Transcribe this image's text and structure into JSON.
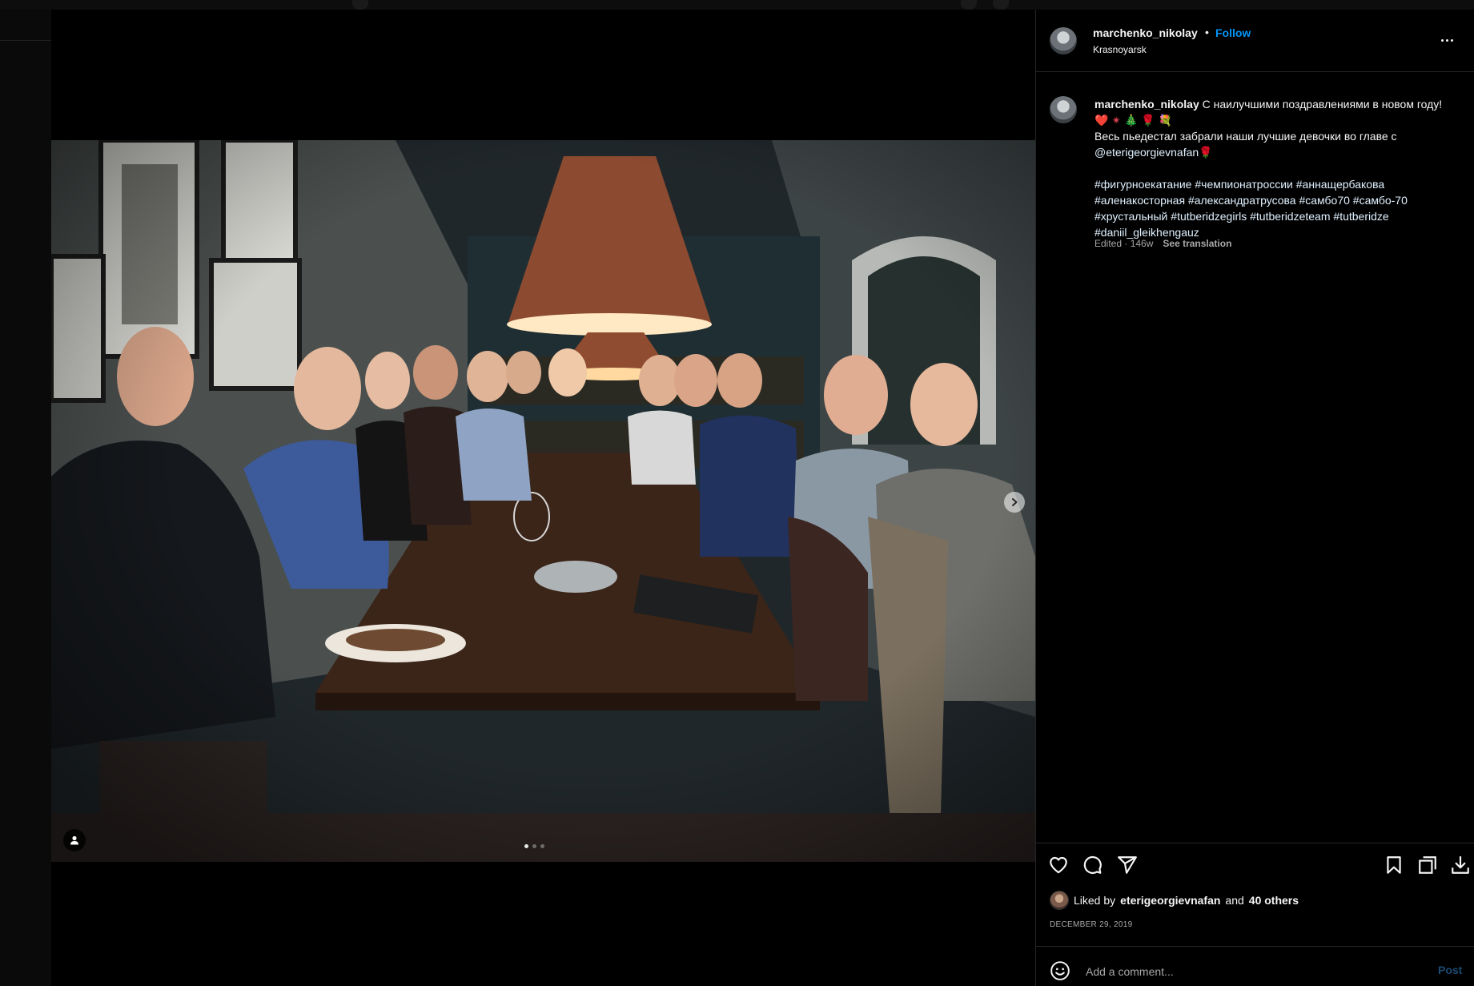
{
  "post": {
    "username": "marchenko_nikolay",
    "follow_label": "Follow",
    "header_separator": "•",
    "location": "Krasnoyarsk"
  },
  "caption": {
    "username": "marchenko_nikolay",
    "line1": " С наилучшими поздравлениями в новом году! ",
    "emoji_heart": "❤️",
    "emoji_sparkle": "✴",
    "emoji_tree": "🎄",
    "emoji_rose": "🌹",
    "emoji_bouquet": "💐",
    "line2": "\nВесь пьедестал забрали наши лучшие девочки во главе с\n",
    "mention": "@eterigeorgievnafan",
    "emoji_rose2": "🌹",
    "hashtags": [
      "#фигурноекатание",
      "#чемпионатроссии",
      "#аннащербакова",
      "#аленакосторная",
      "#александратрусова",
      "#самбо70",
      "#самбо-70",
      "#хрустальный",
      "#tutberidzegirls",
      "#tutberidzeteam",
      "#tutberidze",
      "#daniil_gleikhengauz"
    ],
    "meta_edited": "Edited · 146w",
    "see_translation": "See translation"
  },
  "actions": {
    "icons": [
      "heart-icon",
      "comment-icon",
      "share-icon",
      "bookmark-icon",
      "collection-icon",
      "download-icon"
    ]
  },
  "likes": {
    "prefix": "Liked by",
    "liker": "eterigeorgievnafan",
    "and": "and",
    "others": "40 others"
  },
  "date": "DECEMBER 29, 2019",
  "comment": {
    "placeholder": "Add a comment...",
    "post_label": "Post"
  },
  "carousel": {
    "total": 3,
    "active": 0
  },
  "colors": {
    "accent": "#0095f6",
    "background": "#000000",
    "secondary_text": "#a8a8a8",
    "border": "#262626"
  }
}
